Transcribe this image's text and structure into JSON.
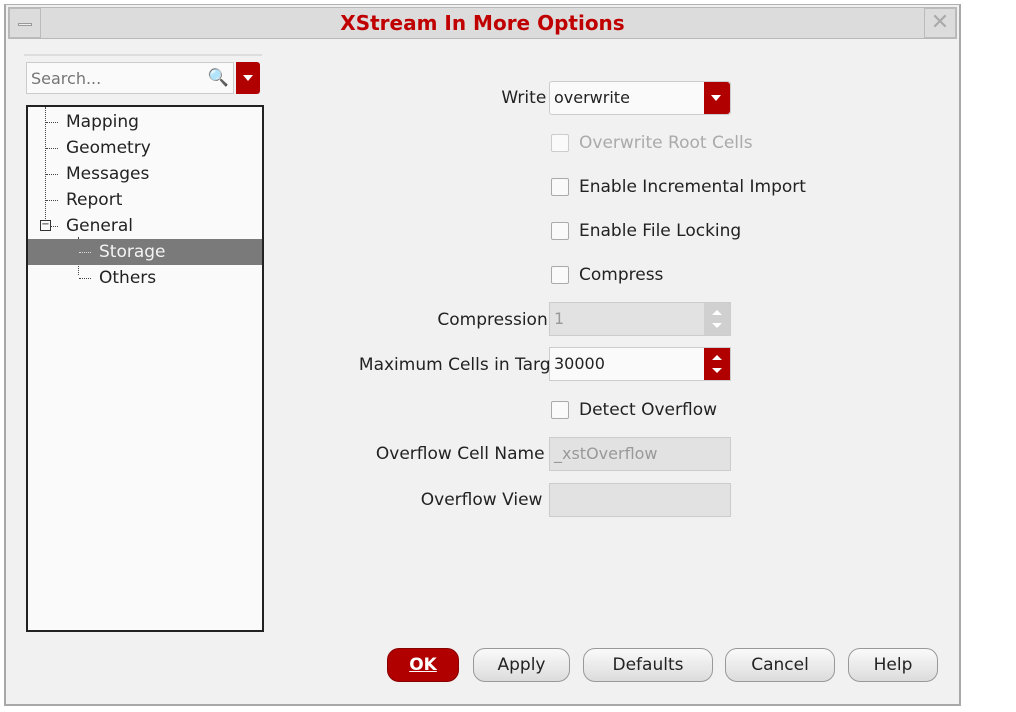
{
  "window": {
    "title": "XStream In More Options"
  },
  "search": {
    "placeholder": "Search..."
  },
  "tree": [
    {
      "label": "Mapping"
    },
    {
      "label": "Geometry"
    },
    {
      "label": "Messages"
    },
    {
      "label": "Report"
    },
    {
      "label": "General",
      "expanded": true
    },
    {
      "label": "Storage",
      "selected": true
    },
    {
      "label": "Others"
    }
  ],
  "form": {
    "write_mode": {
      "label": "Write Mode",
      "value": "overwrite"
    },
    "overwrite_root_cells": {
      "label": "Overwrite Root Cells",
      "checked": false,
      "disabled": true
    },
    "enable_incremental_import": {
      "label": "Enable Incremental Import",
      "checked": false
    },
    "enable_file_locking": {
      "label": "Enable File Locking",
      "checked": false
    },
    "compress": {
      "label": "Compress",
      "checked": false
    },
    "compression_level": {
      "label": "Compression Level",
      "value": "1",
      "disabled": true
    },
    "max_cells": {
      "label": "Maximum Cells in Target Lib",
      "value": "30000"
    },
    "detect_overflow": {
      "label": "Detect Overflow",
      "checked": false
    },
    "overflow_suffix": {
      "label": "Overflow Cell Name Suffix",
      "value": "_xstOverflow",
      "disabled": true
    },
    "overflow_view": {
      "label": "Overflow View Name",
      "value": "",
      "disabled": true
    }
  },
  "buttons": {
    "ok": "OK",
    "apply": "Apply",
    "defaults": "Defaults",
    "cancel": "Cancel",
    "help": "Help"
  },
  "colors": {
    "accent": "#b00000",
    "title": "#c00000",
    "selected": "#7a7a7a"
  }
}
